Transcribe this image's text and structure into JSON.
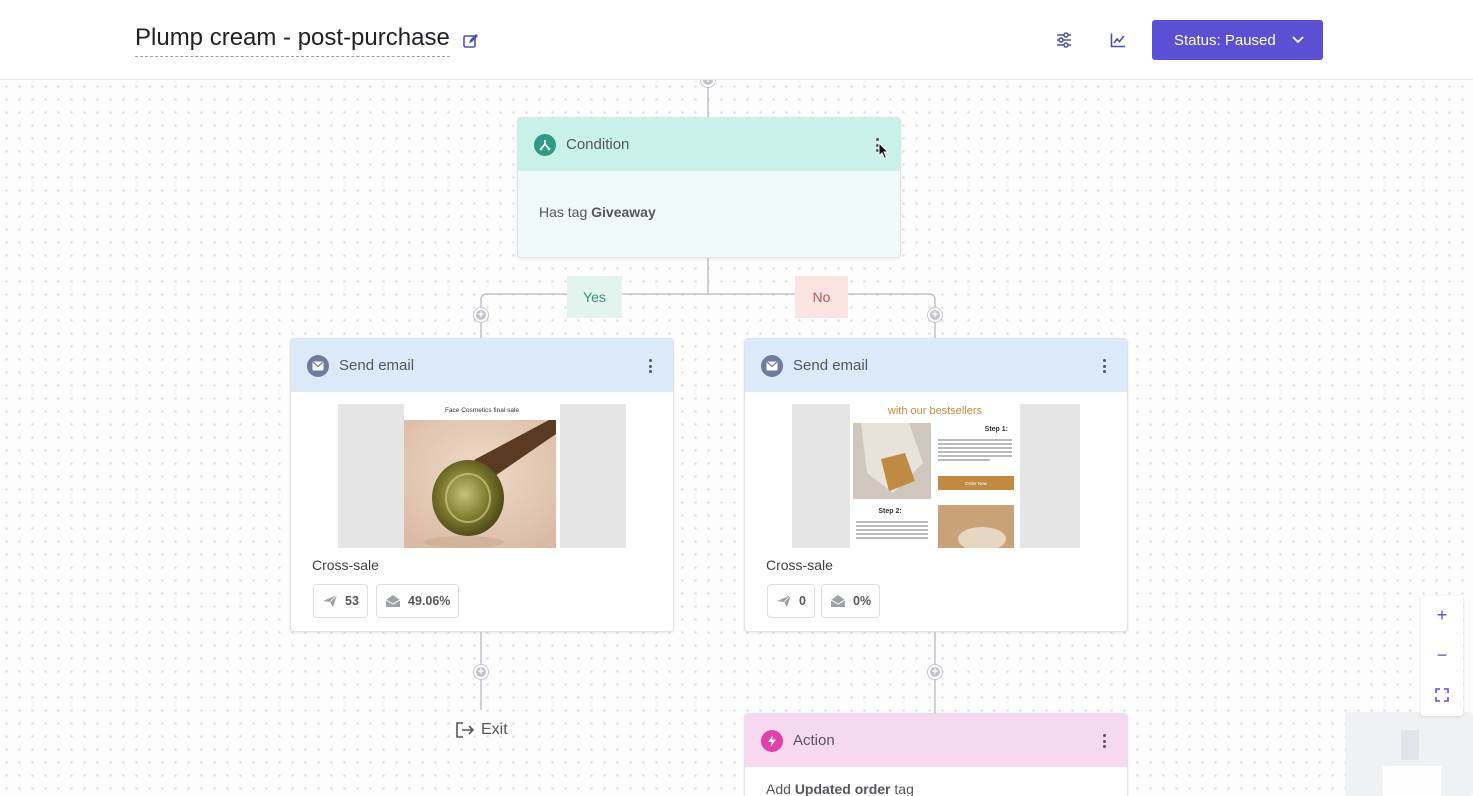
{
  "header": {
    "title": "Plump cream - post-purchase",
    "status_button": "Status: Paused"
  },
  "condition": {
    "title": "Condition",
    "text_prefix": "Has tag",
    "tag": "Giveaway"
  },
  "branches": {
    "yes": "Yes",
    "no": "No"
  },
  "email_yes": {
    "title": "Send email",
    "preview_heading": "Face Cosmetics final sale",
    "caption": "Cross-sale",
    "sent": "53",
    "open_rate": "49.06%"
  },
  "email_no": {
    "title": "Send email",
    "preview_heading": "with our bestsellers",
    "preview_step1": "Step 1:",
    "preview_button": "Order Now",
    "preview_step2": "Step 2:",
    "caption": "Cross-sale",
    "sent": "0",
    "open_rate": "0%"
  },
  "exit_label": "Exit",
  "action": {
    "title": "Action",
    "text_prefix": "Add",
    "tag": "Updated order",
    "text_suffix": "tag"
  },
  "zoom": {
    "in": "+",
    "out": "−"
  },
  "colors": {
    "accent": "#5b4fd3",
    "condition_header": "#c9f1e9",
    "email_header": "#dbe9f9",
    "action_header": "#f6d9ee",
    "condition_icon": "#2f9b86",
    "email_icon": "#6f7aa3",
    "action_icon": "#e040a8"
  },
  "icons": {
    "edit": "pencil-square-icon",
    "settings": "sliders-icon",
    "analytics": "chart-line-icon",
    "status_caret": "chevron-down-icon",
    "condition": "split-icon",
    "email": "envelope-icon",
    "action": "lightning-icon",
    "sent": "paper-plane-icon",
    "opened": "open-envelope-icon",
    "exit": "exit-arrow-icon",
    "zoom_fit": "fullscreen-icon"
  }
}
